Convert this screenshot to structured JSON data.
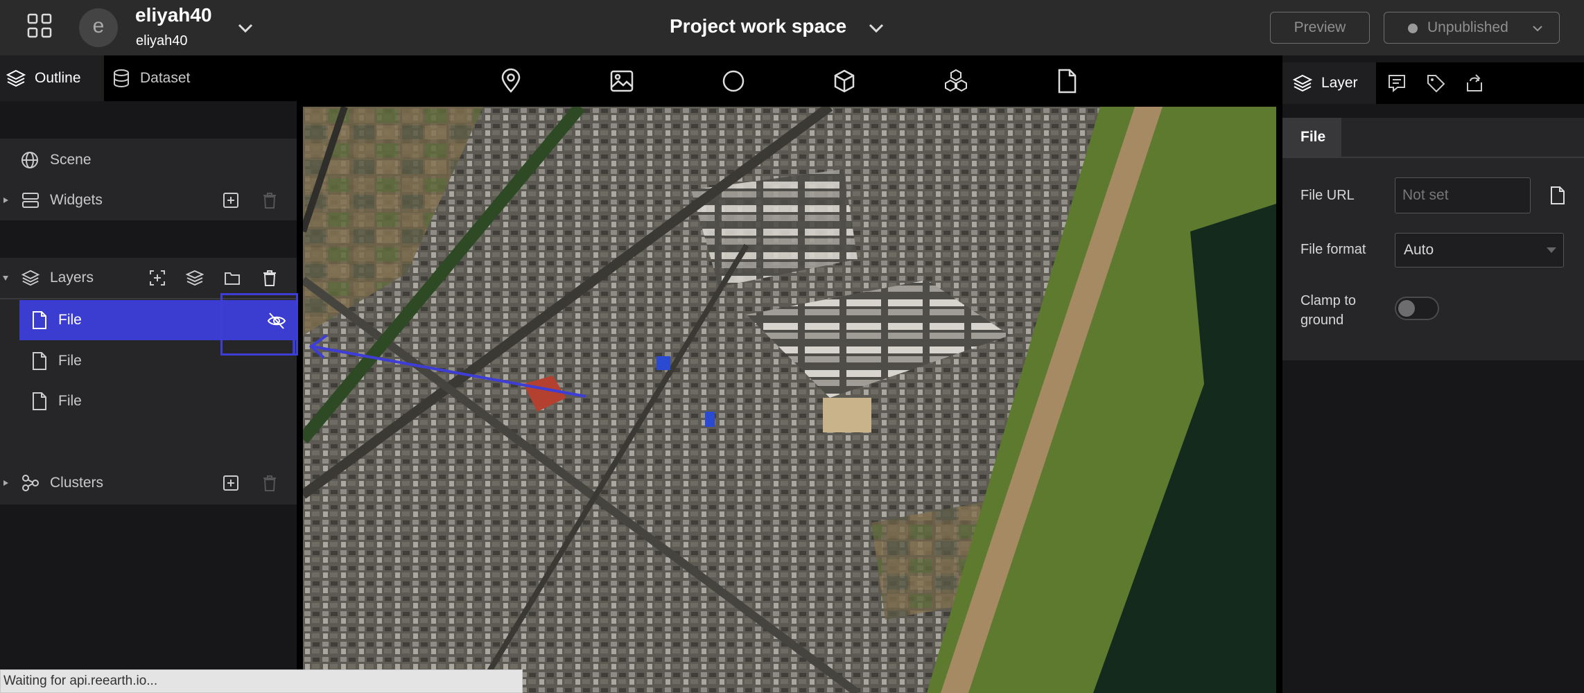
{
  "header": {
    "user": {
      "avatar_letter": "e",
      "name": "eliyah40",
      "subtitle": "eliyah40"
    },
    "project_title": "Project work space",
    "preview_label": "Preview",
    "publish_status": "Unpublished",
    "publish_status_color": "#9a9a9a"
  },
  "left_panel": {
    "tabs": [
      {
        "label": "Outline",
        "icon": "layers-icon",
        "active": true
      },
      {
        "label": "Dataset",
        "icon": "database-icon",
        "active": false
      }
    ],
    "scene_label": "Scene",
    "widgets_label": "Widgets",
    "layers_label": "Layers",
    "layer_items": [
      {
        "label": "File",
        "selected": true,
        "visible": false
      },
      {
        "label": "File",
        "selected": false
      },
      {
        "label": "File",
        "selected": false
      }
    ],
    "clusters_label": "Clusters"
  },
  "toolbar": {
    "tools": [
      "map-pin-icon",
      "image-icon",
      "circle-icon",
      "cube-icon",
      "cubes-icon",
      "file-icon"
    ]
  },
  "right_panel": {
    "tabs": [
      {
        "label": "Layer",
        "icon": "layers-icon",
        "active": true
      },
      {
        "label": "",
        "icon": "infobox-icon"
      },
      {
        "label": "",
        "icon": "tag-icon"
      },
      {
        "label": "",
        "icon": "export-icon"
      }
    ],
    "sub_tab": "File",
    "fields": {
      "file_url_label": "File URL",
      "file_url_placeholder": "Not set",
      "file_format_label": "File format",
      "file_format_value": "Auto",
      "clamp_label": "Clamp to ground",
      "clamp_enabled": false
    }
  },
  "status_bar": {
    "text": "Waiting for api.reearth.io..."
  },
  "colors": {
    "accent": "#3b3cd0",
    "panel_bg": "#171618",
    "section_bg": "#262528",
    "header_bg": "#2b2b2b"
  }
}
